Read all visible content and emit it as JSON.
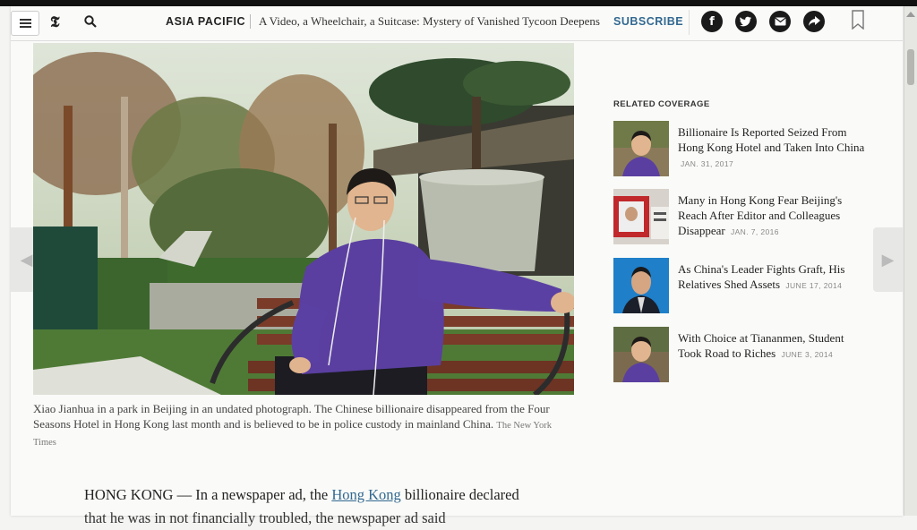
{
  "header": {
    "logo": "𝕿",
    "section": "ASIA PACIFIC",
    "headline": "A Video, a Wheelchair, a Suitcase: Mystery of Vanished Tycoon Deepens",
    "subscribe": "SUBSCRIBE",
    "share_icons": [
      "facebook-icon",
      "twitter-icon",
      "email-icon",
      "share-arrow-icon"
    ]
  },
  "photo": {
    "caption": "Xiao Jianhua in a park in Beijing in an undated photograph. The Chinese billionaire disappeared from the Four Seasons Hotel in Hong Kong last month and is believed to be in police custody in mainland China.",
    "credit": "The New York Times"
  },
  "article": {
    "lead_prefix": "HONG KONG — In a newspaper ad, the ",
    "lead_link": "Hong Kong",
    "lead_suffix": " billionaire declared",
    "lead_next": "that he was in not financially troubled, the newspaper ad said"
  },
  "related": {
    "title": "RELATED COVERAGE",
    "items": [
      {
        "headline": "Billionaire Is Reported Seized From Hong Kong Hotel and Taken Into China",
        "date": "JAN. 31, 2017"
      },
      {
        "headline": "Many in Hong Kong Fear Beijing's Reach After Editor and Colleagues Disappear",
        "date": "JAN. 7, 2016"
      },
      {
        "headline": "As China's Leader Fights Graft, His Relatives Shed Assets",
        "date": "JUNE 17, 2014"
      },
      {
        "headline": "With Choice at Tiananmen, Student Took Road to Riches",
        "date": "JUNE 3, 2014"
      }
    ]
  },
  "nav": {
    "prev": "◀",
    "next": "▶"
  },
  "colors": {
    "link": "#326891",
    "accent_purple": "#5a3fa0"
  }
}
